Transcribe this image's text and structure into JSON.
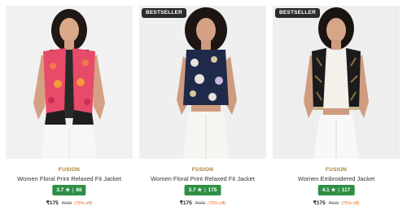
{
  "products": [
    {
      "badge": "",
      "brand": "FUSION",
      "title": "Women Floral Print Relaxed Fit Jacket",
      "rating": "3.7",
      "star": "★",
      "reviews": "66",
      "price": "₹175",
      "mrp": "₹699",
      "discount": "(75% off)"
    },
    {
      "badge": "BESTSELLER",
      "brand": "FUSION",
      "title": "Women Floral Print Relaxed Fit Jacket",
      "rating": "3.7",
      "star": "★",
      "reviews": "175",
      "price": "₹175",
      "mrp": "₹699",
      "discount": "(75% off)"
    },
    {
      "badge": "BESTSELLER",
      "brand": "FUSION",
      "title": "Women Embroidered Jacket",
      "rating": "4.1",
      "star": "★",
      "reviews": "117",
      "price": "₹175",
      "mrp": "₹699",
      "discount": "(75% off)"
    }
  ],
  "colors": {
    "brand_text": "#a67c2e",
    "rating_bg": "#2f8f46",
    "badge_bg": "#2b2b2b",
    "discount_text": "#e86a24"
  },
  "icons": {
    "rating": "star-icon"
  }
}
